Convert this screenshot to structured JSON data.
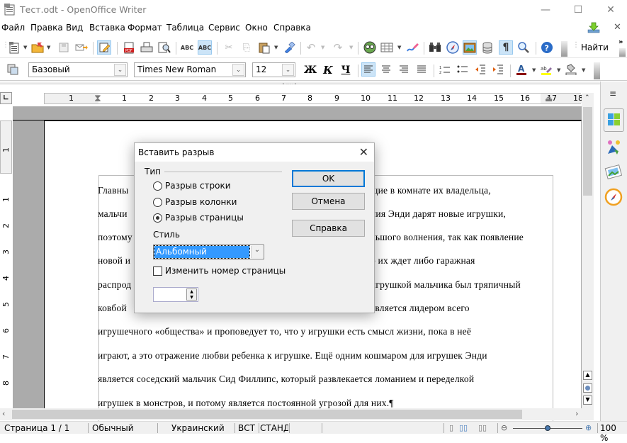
{
  "window": {
    "title": "Тест.odt - OpenOffice Writer",
    "minimize": "—",
    "maximize": "☐",
    "close": "✕"
  },
  "menubar": {
    "items": [
      "Файл",
      "Правка",
      "Вид",
      "Вставка",
      "Формат",
      "Таблица",
      "Сервис",
      "Окно",
      "Справка"
    ],
    "update_icon": "update-download-icon",
    "close_doc": "✕"
  },
  "standard_toolbar": {
    "icons": [
      "new-document-icon",
      "open-folder-icon",
      "save-icon",
      "email-icon",
      "edit-mode-icon",
      "export-pdf-icon",
      "print-icon",
      "print-preview-icon",
      "spellcheck-icon",
      "autospellcheck-icon",
      "cut-icon",
      "copy-icon",
      "paste-icon",
      "clone-format-icon",
      "undo-icon",
      "redo-icon",
      "hyperlink-icon",
      "table-icon",
      "draw-icon",
      "find-replace-icon",
      "navigator-icon",
      "gallery-icon",
      "data-sources-icon",
      "formatting-marks-icon",
      "zoom-icon",
      "help-icon"
    ],
    "find_label": "Найти",
    "more": "»"
  },
  "format_toolbar": {
    "style_value": "Базовый",
    "font_value": "Times New Roman",
    "size_value": "12",
    "bold": "Ж",
    "italic": "К",
    "underline": "Ч"
  },
  "ruler": {
    "h_labels": [
      "1",
      "1",
      "2",
      "3",
      "4",
      "5",
      "6",
      "7",
      "8",
      "9",
      "10",
      "11",
      "12",
      "13",
      "14",
      "15",
      "16",
      "17",
      "18"
    ],
    "v_labels": [
      "1",
      "1",
      "2",
      "3",
      "4",
      "5",
      "6",
      "7",
      "8"
    ]
  },
  "document": {
    "lines": [
      {
        "left": "Главны",
        "right": "щие в комнате их владельца,"
      },
      {
        "left": "мальчи",
        "right": "ния Энди дарят новые игрушки,"
      },
      {
        "left": "поэтому",
        "right": "льшого волнения, так как появление"
      },
      {
        "left": "новой и",
        "right": "о их ждет либо гаражная"
      },
      {
        "left": "распрод",
        "right": "игрушкой мальчика был тряпичный"
      },
      {
        "left": "ковбой",
        "right": "является лидером всего"
      }
    ],
    "full_lines": [
      "игрушечного «общества» и проповедует то, что у игрушки есть смысл жизни, пока в неё",
      "играют, а это отражение любви ребенка к игрушке. Ещё одним кошмаром для игрушек Энди",
      "является соседский мальчик Сид Филлипс, который развлекается ломанием и переделкой",
      "игрушек в монстров, и потому является постоянной угрозой для них.¶"
    ]
  },
  "dialog": {
    "title": "Вставить разрыв",
    "type_group": "Тип",
    "options": [
      "Разрыв строки",
      "Разрыв колонки",
      "Разрыв страницы"
    ],
    "selected_option": 2,
    "style_label": "Стиль",
    "style_value": "Альбомный",
    "change_page_number_label": "Изменить номер страницы",
    "change_page_number_checked": false,
    "page_number_value": "",
    "ok": "OK",
    "cancel": "Отмена",
    "help": "Справка"
  },
  "sidebar": {
    "icons": [
      "sidebar-menu-icon",
      "properties-icon",
      "styles-icon",
      "gallery-icon",
      "navigator-icon"
    ]
  },
  "statusbar": {
    "page": "Страница  1 / 1",
    "page_style": "Обычный",
    "language": "Украинский",
    "insert_mode": "ВСТ",
    "selection_mode": "СТАНД",
    "zoom_percent": "100 %",
    "zoom_level": 100
  }
}
